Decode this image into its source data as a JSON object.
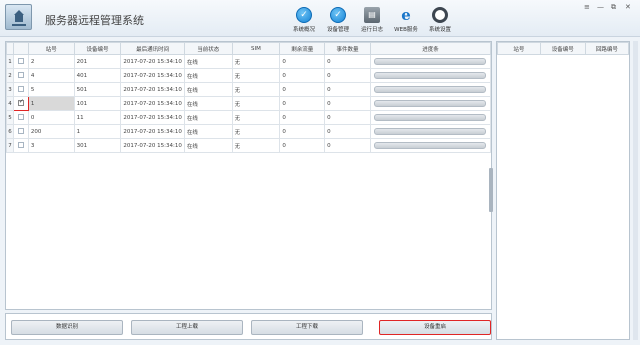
{
  "app": {
    "title": "服务器远程管理系统"
  },
  "nav": [
    {
      "label": "系统概况",
      "icon": "check-circle-icon"
    },
    {
      "label": "设备管理",
      "icon": "check-circle-icon"
    },
    {
      "label": "运行日志",
      "icon": "log-document-icon"
    },
    {
      "label": "WEB服务",
      "icon": "web-e-icon"
    },
    {
      "label": "系统设置",
      "icon": "gear-icon"
    }
  ],
  "window_controls": {
    "menu": "≡",
    "minimize": "—",
    "restore": "⧉",
    "close": "✕"
  },
  "device_table": {
    "columns": [
      "",
      "",
      "站号",
      "设备编号",
      "最后通讯时间",
      "当前状态",
      "SIM",
      "剩余流量",
      "事件数量",
      "进度条"
    ],
    "rows": [
      {
        "row_no": "1",
        "checked": false,
        "station": "2",
        "device": "201",
        "last_comm": "2017-07-20 15:34:10",
        "status": "在线",
        "sim": "无",
        "traffic": "0",
        "events": "0"
      },
      {
        "row_no": "2",
        "checked": false,
        "station": "4",
        "device": "401",
        "last_comm": "2017-07-20 15:34:10",
        "status": "在线",
        "sim": "无",
        "traffic": "0",
        "events": "0"
      },
      {
        "row_no": "3",
        "checked": false,
        "station": "5",
        "device": "501",
        "last_comm": "2017-07-20 15:34:10",
        "status": "在线",
        "sim": "无",
        "traffic": "0",
        "events": "0"
      },
      {
        "row_no": "4",
        "checked": true,
        "station": "1",
        "device": "101",
        "last_comm": "2017-07-20 15:34:10",
        "status": "在线",
        "sim": "无",
        "traffic": "0",
        "events": "0"
      },
      {
        "row_no": "5",
        "checked": false,
        "station": "0",
        "device": "11",
        "last_comm": "2017-07-20 15:34:10",
        "status": "在线",
        "sim": "无",
        "traffic": "0",
        "events": "0"
      },
      {
        "row_no": "6",
        "checked": false,
        "station": "200",
        "device": "1",
        "last_comm": "2017-07-20 15:34:10",
        "status": "在线",
        "sim": "无",
        "traffic": "0",
        "events": "0"
      },
      {
        "row_no": "7",
        "checked": false,
        "station": "3",
        "device": "301",
        "last_comm": "2017-07-20 15:34:10",
        "status": "在线",
        "sim": "无",
        "traffic": "0",
        "events": "0"
      }
    ]
  },
  "side_table": {
    "columns": [
      "站号",
      "设备编号",
      "回路编号"
    ]
  },
  "buttons": {
    "data_recognize": "数据识别",
    "project_upload": "工程上载",
    "project_download": "工程下载",
    "device_restart": "设备重启"
  },
  "colors": {
    "highlight": "#e02525",
    "nav_accent": "#1583d6"
  }
}
